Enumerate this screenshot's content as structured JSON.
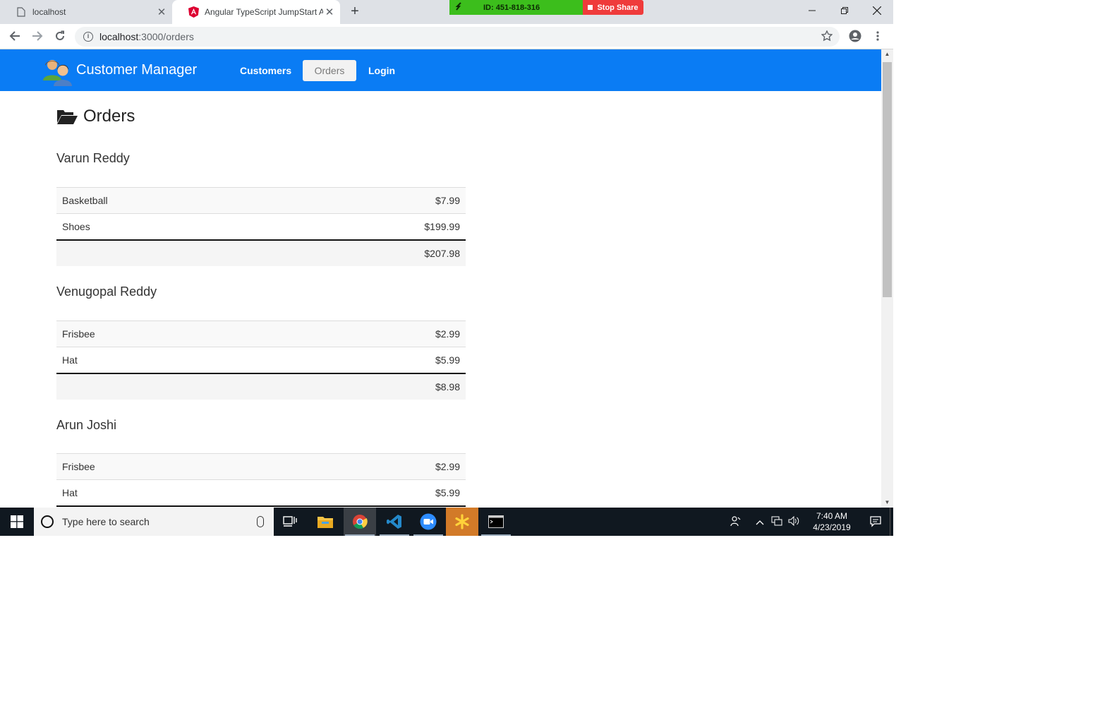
{
  "browser": {
    "tabs": [
      {
        "title": "localhost"
      },
      {
        "title": "Angular TypeScript JumpStart Ap"
      }
    ],
    "share": {
      "id": "ID: 451-818-316",
      "stop_label": "Stop Share"
    },
    "url_host": "localhost",
    "url_path": ":3000/orders"
  },
  "app": {
    "brand": "Customer Manager",
    "nav": [
      {
        "label": "Customers"
      },
      {
        "label": "Orders",
        "active": true
      },
      {
        "label": "Login"
      }
    ],
    "accent_color": "#0a7cf4"
  },
  "page": {
    "title": "Orders",
    "customers": [
      {
        "name": "Varun Reddy",
        "items": [
          {
            "product": "Basketball",
            "price": "$7.99"
          },
          {
            "product": "Shoes",
            "price": "$199.99"
          }
        ],
        "total": "$207.98"
      },
      {
        "name": "Venugopal Reddy",
        "items": [
          {
            "product": "Frisbee",
            "price": "$2.99"
          },
          {
            "product": "Hat",
            "price": "$5.99"
          }
        ],
        "total": "$8.98"
      },
      {
        "name": "Arun Joshi",
        "items": [
          {
            "product": "Frisbee",
            "price": "$2.99"
          },
          {
            "product": "Hat",
            "price": "$5.99"
          }
        ]
      }
    ]
  },
  "taskbar": {
    "search_placeholder": "Type here to search",
    "time": "7:40 AM",
    "date": "4/23/2019"
  }
}
